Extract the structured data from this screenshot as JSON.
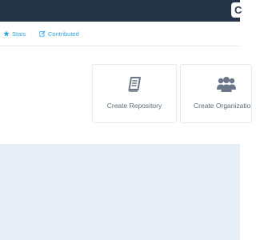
{
  "topbar": {
    "user_initial": "C"
  },
  "tabs": [
    {
      "label": "Stars",
      "icon": "star-icon"
    },
    {
      "label": "Contributed",
      "icon": "edit-icon"
    }
  ],
  "cards": [
    {
      "label": "Create Repository",
      "icon": "book-icon"
    },
    {
      "label": "Create Organization",
      "icon": "users-icon"
    }
  ],
  "colors": {
    "topbar_bg": "#253446",
    "link": "#2fa4e7",
    "card_text": "#5e6b7a",
    "icon": "#6b7788",
    "footer_bg": "#e8eef5"
  }
}
